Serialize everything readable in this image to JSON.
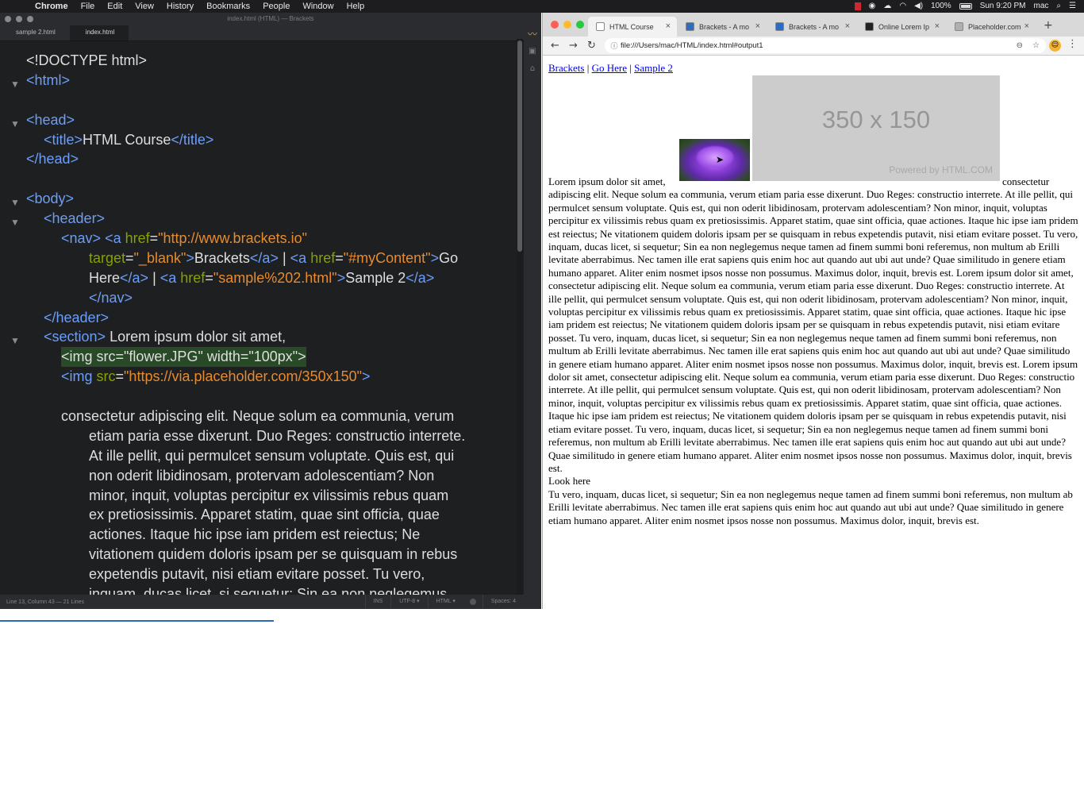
{
  "menubar": {
    "apple": "",
    "items": [
      "Chrome",
      "File",
      "Edit",
      "View",
      "History",
      "Bookmarks",
      "People",
      "Window",
      "Help"
    ],
    "battery": "100%",
    "clock": "Sun 9:20 PM",
    "user": "mac"
  },
  "brackets": {
    "window_title": "index.html (HTML) — Brackets",
    "tabs": [
      "sample 2.html",
      "index.html"
    ],
    "active_tab": "index.html",
    "status": {
      "position": "Line 13, Column 43 — 21 Lines",
      "mode": "INS",
      "encoding": "UTF-8 ▾",
      "language": "HTML ▾",
      "spaces": "Spaces: 4"
    }
  },
  "code_lines": [
    {
      "fold": false,
      "indent": 0,
      "tokens": [
        [
          "tx",
          "<!DOCTYPE html>"
        ]
      ]
    },
    {
      "fold": true,
      "indent": 0,
      "tokens": [
        [
          "tg",
          "<html>"
        ]
      ]
    },
    {
      "fold": false,
      "indent": 0,
      "tokens": []
    },
    {
      "fold": true,
      "indent": 0,
      "tokens": [
        [
          "tg",
          "<head>"
        ]
      ]
    },
    {
      "fold": false,
      "indent": 1,
      "tokens": [
        [
          "tg",
          "<title>"
        ],
        [
          "tx",
          "HTML Course"
        ],
        [
          "tg",
          "</title>"
        ]
      ]
    },
    {
      "fold": false,
      "indent": 0,
      "tokens": [
        [
          "tg",
          "</head>"
        ]
      ]
    },
    {
      "fold": false,
      "indent": 0,
      "tokens": []
    },
    {
      "fold": true,
      "indent": 0,
      "tokens": [
        [
          "tg",
          "<body>"
        ]
      ]
    },
    {
      "fold": true,
      "indent": 1,
      "tokens": [
        [
          "tg",
          "<header>"
        ]
      ]
    },
    {
      "fold": false,
      "indent": 2,
      "tokens": [
        [
          "tg",
          "<nav>"
        ],
        [
          "tx",
          " "
        ],
        [
          "tg",
          "<a "
        ],
        [
          "at",
          "href"
        ],
        [
          "tx",
          "="
        ],
        [
          "st",
          "\"http://www.brackets.io\""
        ]
      ]
    },
    {
      "fold": false,
      "indent": 3,
      "tokens": [
        [
          "at",
          "target"
        ],
        [
          "tx",
          "="
        ],
        [
          "st",
          "\"_blank\""
        ],
        [
          "tg",
          ">"
        ],
        [
          "tx",
          "Brackets"
        ],
        [
          "tg",
          "</a>"
        ],
        [
          "tx",
          " | "
        ],
        [
          "tg",
          "<a "
        ],
        [
          "at",
          "href"
        ],
        [
          "tx",
          "="
        ],
        [
          "st",
          "\"#myContent\""
        ],
        [
          "tg",
          ">"
        ],
        [
          "tx",
          "Go"
        ]
      ]
    },
    {
      "fold": false,
      "indent": 3,
      "tokens": [
        [
          "tx",
          "Here"
        ],
        [
          "tg",
          "</a>"
        ],
        [
          "tx",
          " | "
        ],
        [
          "tg",
          "<a "
        ],
        [
          "at",
          "href"
        ],
        [
          "tx",
          "="
        ],
        [
          "st",
          "\"sample%202.html\""
        ],
        [
          "tg",
          ">"
        ],
        [
          "tx",
          "Sample 2"
        ],
        [
          "tg",
          "</a>"
        ]
      ]
    },
    {
      "fold": false,
      "indent": 3,
      "tokens": [
        [
          "tg",
          "</nav>"
        ]
      ]
    },
    {
      "fold": false,
      "indent": 1,
      "tokens": [
        [
          "tg",
          "</header>"
        ]
      ]
    },
    {
      "fold": true,
      "indent": 1,
      "tokens": [
        [
          "tg",
          "<section>"
        ],
        [
          "tx",
          " Lorem ipsum dolor sit amet,"
        ]
      ]
    },
    {
      "fold": false,
      "indent": 2,
      "highlight": true,
      "tokens": [
        [
          "tx",
          "<img src=\"flower.JPG\" width=\"100px\">"
        ]
      ]
    },
    {
      "fold": false,
      "indent": 2,
      "tokens": [
        [
          "tg",
          "<img "
        ],
        [
          "at",
          "src"
        ],
        [
          "tx",
          "="
        ],
        [
          "st",
          "\"https://via.placeholder.com/350x150\""
        ],
        [
          "tg",
          ">"
        ]
      ]
    },
    {
      "fold": false,
      "indent": 0,
      "tokens": []
    },
    {
      "fold": false,
      "indent": 2,
      "tokens": [
        [
          "tx",
          "consectetur adipiscing elit. Neque solum ea communia, verum"
        ]
      ]
    },
    {
      "fold": false,
      "indent": 3,
      "tokens": [
        [
          "tx",
          "etiam paria esse dixerunt. Duo Reges: constructio interrete."
        ]
      ]
    },
    {
      "fold": false,
      "indent": 3,
      "tokens": [
        [
          "tx",
          "At ille pellit, qui permulcet sensum voluptate. Quis est, qui"
        ]
      ]
    },
    {
      "fold": false,
      "indent": 3,
      "tokens": [
        [
          "tx",
          "non oderit libidinosam, protervam adolescentiam? Non"
        ]
      ]
    },
    {
      "fold": false,
      "indent": 3,
      "tokens": [
        [
          "tx",
          "minor, inquit, voluptas percipitur ex vilissimis rebus quam"
        ]
      ]
    },
    {
      "fold": false,
      "indent": 3,
      "tokens": [
        [
          "tx",
          "ex pretiosissimis. Apparet statim, quae sint officia, quae"
        ]
      ]
    },
    {
      "fold": false,
      "indent": 3,
      "tokens": [
        [
          "tx",
          "actiones. Itaque hic ipse iam pridem est reiectus; Ne"
        ]
      ]
    },
    {
      "fold": false,
      "indent": 3,
      "tokens": [
        [
          "tx",
          "vitationem quidem doloris ipsam per se quisquam in rebus"
        ]
      ]
    },
    {
      "fold": false,
      "indent": 3,
      "tokens": [
        [
          "tx",
          "expetendis putavit, nisi etiam evitare posset. Tu vero,"
        ]
      ]
    },
    {
      "fold": false,
      "indent": 3,
      "tokens": [
        [
          "tx",
          "inquam, ducas licet, si sequetur; Sin ea non neglegemus"
        ]
      ]
    }
  ],
  "chrome": {
    "tabs": [
      {
        "label": "HTML Course",
        "active": true,
        "favicon_color": "#ffffff"
      },
      {
        "label": "Brackets - A mo",
        "active": false,
        "favicon_color": "#2b6cc4"
      },
      {
        "label": "Brackets - A mo",
        "active": false,
        "favicon_color": "#2b6cc4"
      },
      {
        "label": "Online Lorem Ip",
        "active": false,
        "favicon_color": "#222222"
      },
      {
        "label": "Placeholder.com",
        "active": false,
        "favicon_color": "#b0b0b0"
      }
    ],
    "url": "file:///Users/mac/HTML/index.html#output1"
  },
  "page": {
    "nav": {
      "brackets": "Brackets",
      "sep1": " | ",
      "go_here": "Go Here",
      "sep2": " | ",
      "sample2": "Sample 2"
    },
    "placeholder_text": "350 x 150",
    "placeholder_credit": "Powered by HTML.COM",
    "lead_text": "Lorem ipsum dolor sit amet,",
    "after_text": "consectetur",
    "body_text": "adipiscing elit. Neque solum ea communia, verum etiam paria esse dixerunt. Duo Reges: constructio interrete. At ille pellit, qui permulcet sensum voluptate. Quis est, qui non oderit libidinosam, protervam adolescentiam? Non minor, inquit, voluptas percipitur ex vilissimis rebus quam ex pretiosissimis. Apparet statim, quae sint officia, quae actiones. Itaque hic ipse iam pridem est reiectus; Ne vitationem quidem doloris ipsam per se quisquam in rebus expetendis putavit, nisi etiam evitare posset. Tu vero, inquam, ducas licet, si sequetur; Sin ea non neglegemus neque tamen ad finem summi boni referemus, non multum ab Erilli levitate aberrabimus. Nec tamen ille erat sapiens quis enim hoc aut quando aut ubi aut unde? Quae similitudo in genere etiam humano apparet. Aliter enim nosmet ipsos nosse non possumus. Maximus dolor, inquit, brevis est. Lorem ipsum dolor sit amet, consectetur adipiscing elit. Neque solum ea communia, verum etiam paria esse dixerunt. Duo Reges: constructio interrete. At ille pellit, qui permulcet sensum voluptate. Quis est, qui non oderit libidinosam, protervam adolescentiam? Non minor, inquit, voluptas percipitur ex vilissimis rebus quam ex pretiosissimis. Apparet statim, quae sint officia, quae actiones. Itaque hic ipse iam pridem est reiectus; Ne vitationem quidem doloris ipsam per se quisquam in rebus expetendis putavit, nisi etiam evitare posset. Tu vero, inquam, ducas licet, si sequetur; Sin ea non neglegemus neque tamen ad finem summi boni referemus, non multum ab Erilli levitate aberrabimus. Nec tamen ille erat sapiens quis enim hoc aut quando aut ubi aut unde? Quae similitudo in genere etiam humano apparet. Aliter enim nosmet ipsos nosse non possumus. Maximus dolor, inquit, brevis est. Lorem ipsum dolor sit amet, consectetur adipiscing elit. Neque solum ea communia, verum etiam paria esse dixerunt. Duo Reges: constructio interrete. At ille pellit, qui permulcet sensum voluptate. Quis est, qui non oderit libidinosam, protervam adolescentiam? Non minor, inquit, voluptas percipitur ex vilissimis rebus quam ex pretiosissimis. Apparet statim, quae sint officia, quae actiones. Itaque hic ipse iam pridem est reiectus; Ne vitationem quidem doloris ipsam per se quisquam in rebus expetendis putavit, nisi etiam evitare posset. Tu vero, inquam, ducas licet, si sequetur; Sin ea non neglegemus neque tamen ad finem summi boni referemus, non multum ab Erilli levitate aberrabimus. Nec tamen ille erat sapiens quis enim hoc aut quando aut ubi aut unde? Quae similitudo in genere etiam humano apparet. Aliter enim nosmet ipsos nosse non possumus. Maximus dolor, inquit, brevis est.",
    "look_here": "Look here",
    "footer_text": "Tu vero, inquam, ducas licet, si sequetur; Sin ea non neglegemus neque tamen ad finem summi boni referemus, non multum ab Erilli levitate aberrabimus. Nec tamen ille erat sapiens quis enim hoc aut quando aut ubi aut unde? Quae similitudo in genere etiam humano apparet. Aliter enim nosmet ipsos nosse non possumus. Maximus dolor, inquit, brevis est."
  }
}
